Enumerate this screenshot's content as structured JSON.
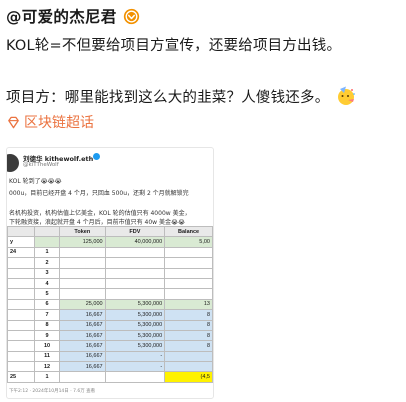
{
  "post": {
    "author": "@可爱的杰尼君",
    "paragraph1": "KOL轮=不但要给项目方宣传，还要给项目方出钱。",
    "paragraph2": "项目方：哪里能找到这么大的韭菜？人傻钱还多。",
    "topic": "区块链超话",
    "accent_color": "#eb7340",
    "verified_color": "#f29100"
  },
  "screenshot": {
    "name": "刘德华 kithewolf.eth",
    "handle": "@kiTTheWolf",
    "line1": "KOL 轮到了😭😭😭",
    "line2": "000u，目前已经开盘 4 个月，只回血 500u，还剩 2 个月就解锁完",
    "line3": "名机构投资，机构估值上亿美金，KOL 轮的估值只有 4000w 美金，",
    "line4": "下轮融资接，浪起就开盘 4 个月后，目前市值只有 40w 美金😭😭",
    "timestamp": "下午2:12 · 2024年10月14日 · 7.6万 查看",
    "sheet": {
      "headers": [
        "Token",
        "FDV",
        "Balance"
      ],
      "first_row": {
        "label": "y",
        "token": "125,000",
        "fdv": "40,000,000",
        "balance": "5,00"
      },
      "rows": [
        {
          "label": "24",
          "idx": "1",
          "token": "",
          "fdv": "",
          "balance": ""
        },
        {
          "label": "",
          "idx": "2",
          "token": "",
          "fdv": "",
          "balance": ""
        },
        {
          "label": "",
          "idx": "3",
          "token": "",
          "fdv": "",
          "balance": ""
        },
        {
          "label": "",
          "idx": "4",
          "token": "",
          "fdv": "",
          "balance": ""
        },
        {
          "label": "",
          "idx": "5",
          "token": "",
          "fdv": "",
          "balance": ""
        },
        {
          "label": "",
          "idx": "6",
          "token": "25,000",
          "fdv": "5,300,000",
          "balance": "13"
        },
        {
          "label": "",
          "idx": "7",
          "token": "16,667",
          "fdv": "5,300,000",
          "balance": "8"
        },
        {
          "label": "",
          "idx": "8",
          "token": "16,667",
          "fdv": "5,300,000",
          "balance": "8"
        },
        {
          "label": "",
          "idx": "9",
          "token": "16,667",
          "fdv": "5,300,000",
          "balance": "8"
        },
        {
          "label": "",
          "idx": "10",
          "token": "16,667",
          "fdv": "5,300,000",
          "balance": "8"
        },
        {
          "label": "",
          "idx": "11",
          "token": "16,667",
          "fdv": "-",
          "balance": ""
        },
        {
          "label": "",
          "idx": "12",
          "token": "16,667",
          "fdv": "-",
          "balance": ""
        },
        {
          "label": "25",
          "idx": "1",
          "token": "",
          "fdv": "",
          "balance": "(4,5"
        }
      ]
    }
  }
}
